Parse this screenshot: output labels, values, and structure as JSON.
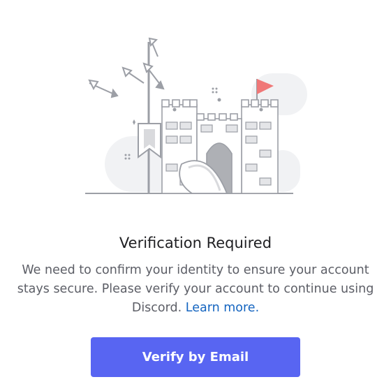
{
  "modal": {
    "title": "Verification Required",
    "body_prefix": "We need to confirm your identity to ensure your account stays secure. Please verify your account to continue using Discord.",
    "link_text": "Learn more.",
    "button_label": "Verify by Email"
  },
  "colors": {
    "button": "#5865f2",
    "link": "#1565c0",
    "flag": "#f07878",
    "illustration_bg": "#f1f2f4"
  },
  "icons": [
    "castle-illustration",
    "arrow-icon",
    "flag-icon",
    "banner-icon"
  ]
}
